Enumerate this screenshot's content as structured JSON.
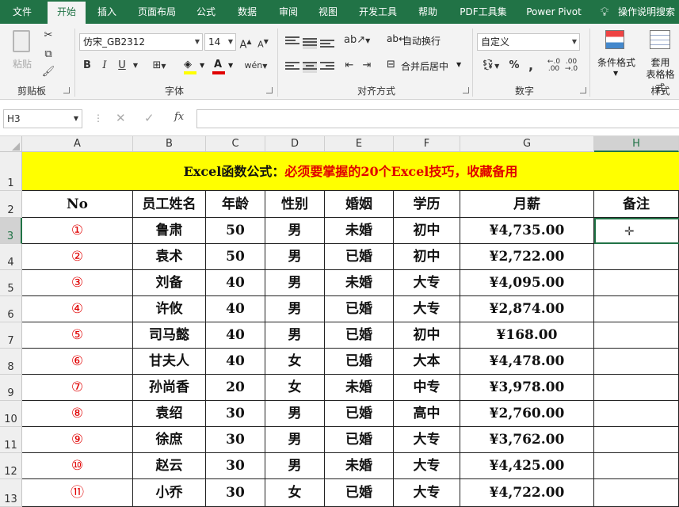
{
  "ribbon_tabs": [
    "文件",
    "开始",
    "插入",
    "页面布局",
    "公式",
    "数据",
    "审阅",
    "视图",
    "开发工具",
    "帮助",
    "PDF工具集",
    "Power Pivot"
  ],
  "active_tab": "开始",
  "tell_me": "操作说明搜索",
  "clipboard": {
    "paste_label": "粘贴",
    "group_label": "剪贴板"
  },
  "font": {
    "name": "仿宋_GB2312",
    "size": "14",
    "bold": "B",
    "italic": "I",
    "underline": "U",
    "group_label": "字体"
  },
  "alignment": {
    "wrap_label": "自动换行",
    "merge_label": "合并后居中",
    "group_label": "对齐方式"
  },
  "number": {
    "format": "自定义",
    "group_label": "数字",
    "percent": "%",
    "comma": ","
  },
  "styles": {
    "cond_format_label": "条件格式",
    "table_format_line1": "套用",
    "table_format_line2": "表格格式",
    "group_label": "样式"
  },
  "formula_bar": {
    "name_box": "H3",
    "fx": "fx",
    "value": ""
  },
  "columns": [
    "A",
    "B",
    "C",
    "D",
    "E",
    "F",
    "G",
    "H"
  ],
  "selected_column": "H",
  "rows": [
    "1",
    "2",
    "3",
    "4",
    "5",
    "6",
    "7",
    "8",
    "9",
    "10",
    "11",
    "12",
    "13"
  ],
  "selected_row": "3",
  "sheet": {
    "title_part1": "Excel函数公式：",
    "title_part2": "必须要掌握的20个Excel技巧，收藏备用",
    "headers": [
      "No",
      "员工姓名",
      "年龄",
      "性别",
      "婚姻",
      "学历",
      "月薪",
      "备注"
    ],
    "data": [
      [
        "①",
        "鲁肃",
        "50",
        "男",
        "未婚",
        "初中",
        "¥4,735.00",
        ""
      ],
      [
        "②",
        "袁术",
        "50",
        "男",
        "已婚",
        "初中",
        "¥2,722.00",
        ""
      ],
      [
        "③",
        "刘备",
        "40",
        "男",
        "未婚",
        "大专",
        "¥4,095.00",
        ""
      ],
      [
        "④",
        "许攸",
        "40",
        "男",
        "已婚",
        "大专",
        "¥2,874.00",
        ""
      ],
      [
        "⑤",
        "司马懿",
        "40",
        "男",
        "已婚",
        "初中",
        "¥168.00",
        ""
      ],
      [
        "⑥",
        "甘夫人",
        "40",
        "女",
        "已婚",
        "大本",
        "¥4,478.00",
        ""
      ],
      [
        "⑦",
        "孙尚香",
        "20",
        "女",
        "未婚",
        "中专",
        "¥3,978.00",
        ""
      ],
      [
        "⑧",
        "袁绍",
        "30",
        "男",
        "已婚",
        "高中",
        "¥2,760.00",
        ""
      ],
      [
        "⑨",
        "徐庶",
        "30",
        "男",
        "已婚",
        "大专",
        "¥3,762.00",
        ""
      ],
      [
        "⑩",
        "赵云",
        "30",
        "男",
        "未婚",
        "大专",
        "¥4,425.00",
        ""
      ],
      [
        "⑪",
        "小乔",
        "30",
        "女",
        "已婚",
        "大专",
        "¥4,722.00",
        ""
      ]
    ]
  },
  "colors": {
    "accent": "#217346",
    "title_fill": "#ffff00",
    "red": "#e00000"
  }
}
